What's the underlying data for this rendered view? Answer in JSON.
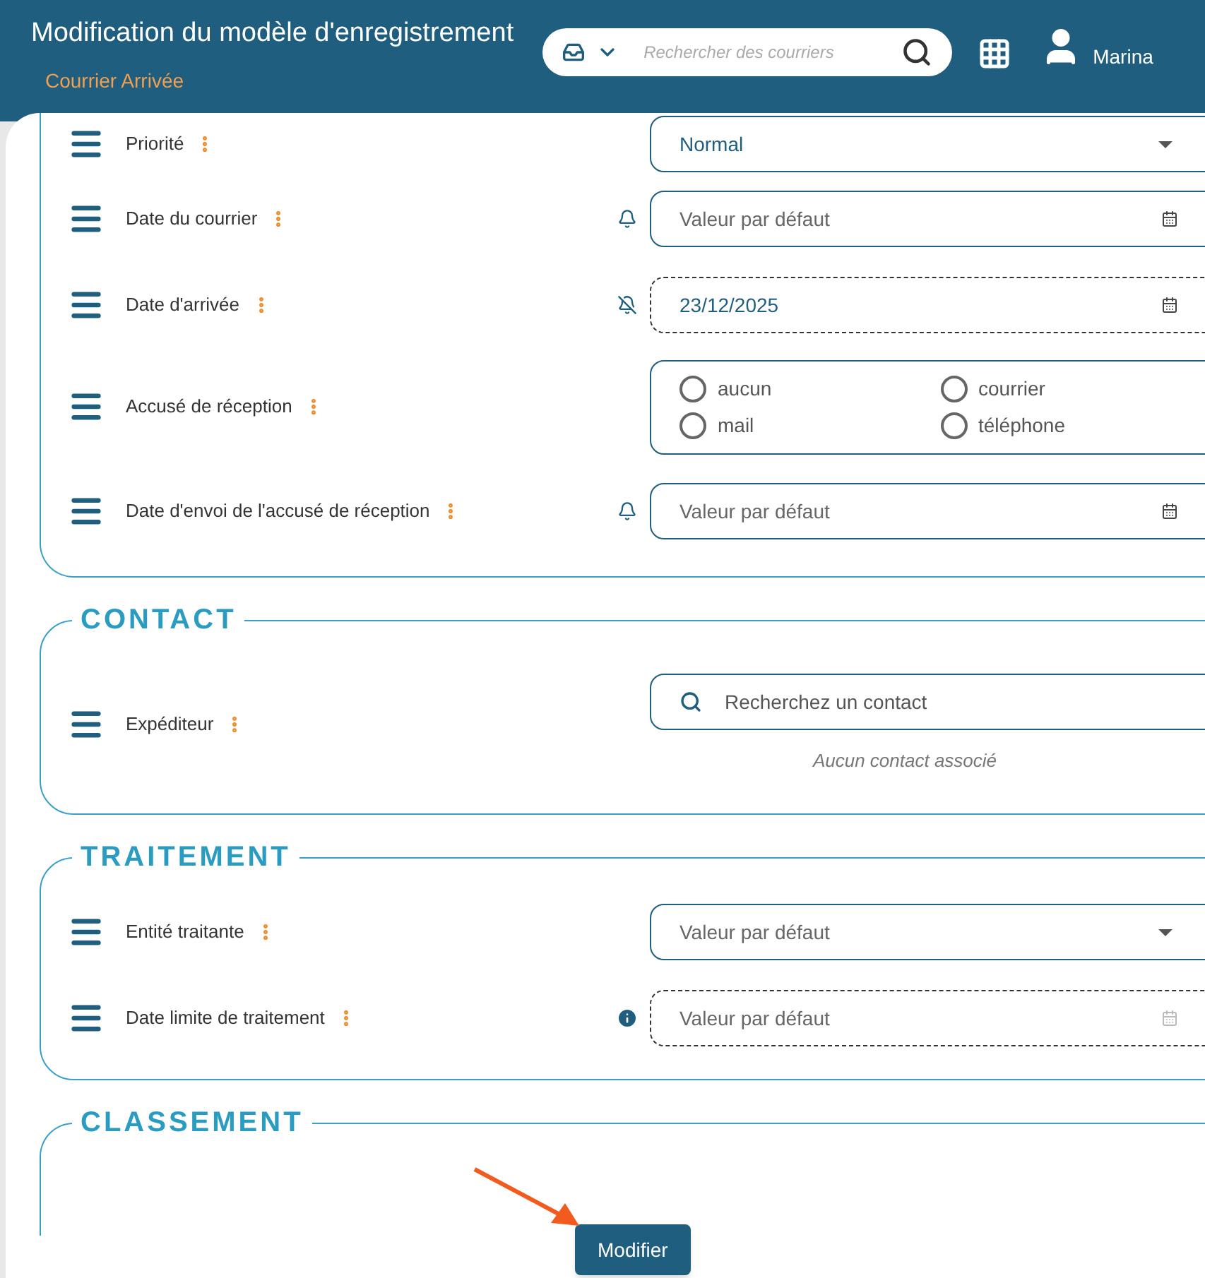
{
  "header": {
    "title": "Modification du modèle d'enregistrement",
    "subtitle": "Courrier Arrivée",
    "search": {
      "placeholder": "Rechercher des courriers"
    },
    "user": "Marina"
  },
  "sections": [
    {
      "rows": [
        {
          "label": "Priorité",
          "kind": "select",
          "value": "Normal",
          "dashed": false
        },
        {
          "label": "Date du courrier",
          "kind": "date",
          "reminder": true,
          "placeholder": "Valeur par défaut",
          "dashed": false
        },
        {
          "label": "Date d'arrivée",
          "kind": "date",
          "reminder": false,
          "value": "23/12/2025",
          "dashed": true
        },
        {
          "label": "Accusé de réception",
          "kind": "radio",
          "dashed": false,
          "options": [
            {
              "label": "aucun",
              "selected": false
            },
            {
              "label": "courrier",
              "selected": false
            },
            {
              "label": "mail",
              "selected": false
            },
            {
              "label": "téléphone",
              "selected": false
            }
          ]
        },
        {
          "label": "Date d'envoi de l'accusé de réception",
          "kind": "date",
          "reminder": true,
          "placeholder": "Valeur par défaut",
          "dashed": false
        }
      ]
    },
    {
      "title": "CONTACT",
      "rows": [
        {
          "label": "Expéditeur",
          "kind": "contact",
          "placeholder": "Recherchez un contact",
          "help": "Aucun contact associé",
          "dashed": false
        }
      ]
    },
    {
      "title": "TRAITEMENT",
      "rows": [
        {
          "label": "Entité traitante",
          "kind": "select",
          "placeholder": "Valeur par défaut",
          "dashed": false
        },
        {
          "label": "Date limite de traitement",
          "kind": "date",
          "info": true,
          "placeholder": "Valeur par défaut",
          "dashed": true,
          "disabled": true
        }
      ]
    },
    {
      "title": "CLASSEMENT"
    }
  ],
  "submit": "Modifier"
}
